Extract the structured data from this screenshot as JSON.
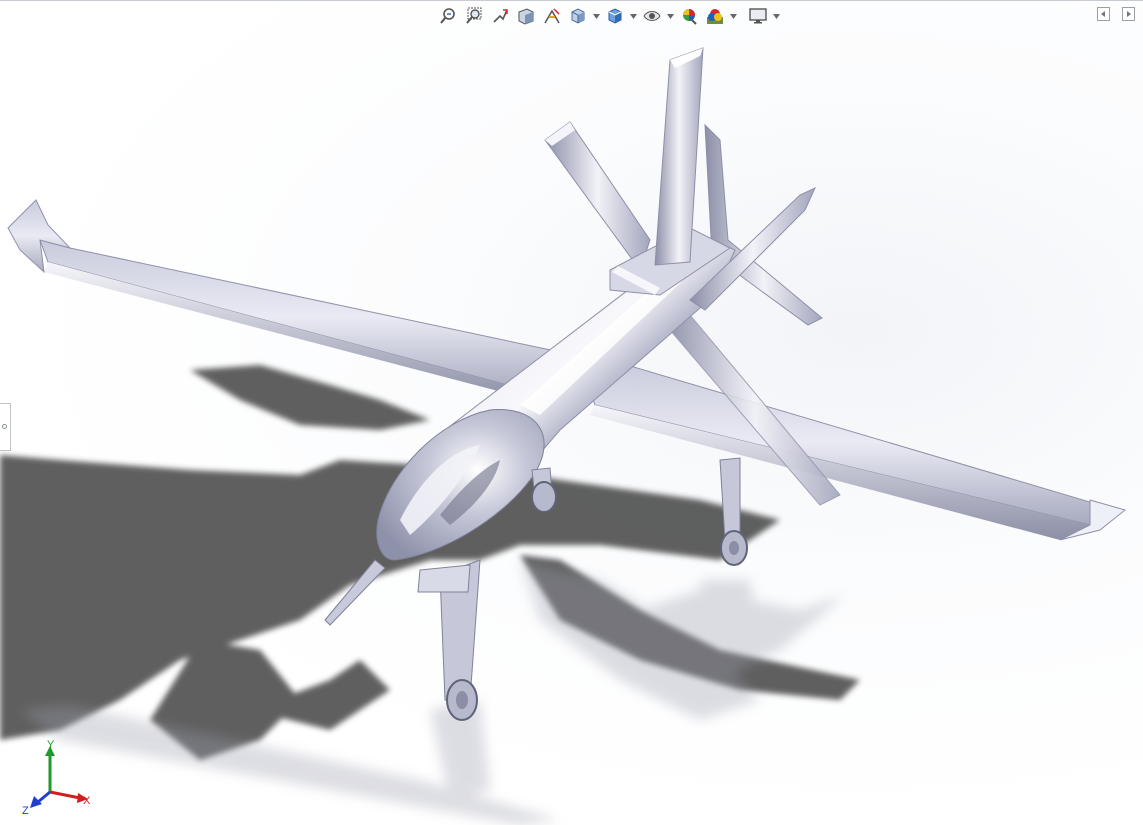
{
  "window": {
    "title": ""
  },
  "heads_up_toolbar": {
    "buttons": [
      {
        "name": "zoom-to-fit",
        "icon": "zoom-to-fit-icon"
      },
      {
        "name": "zoom-to-area",
        "icon": "zoom-to-area-icon"
      },
      {
        "name": "previous-view",
        "icon": "previous-view-icon"
      },
      {
        "name": "section-view",
        "icon": "section-view-icon"
      },
      {
        "name": "dynamic-annotation-views",
        "icon": "dynamic-annotation-icon"
      },
      {
        "name": "view-orientation",
        "icon": "view-orientation-icon",
        "dropdown": true
      },
      {
        "name": "display-style",
        "icon": "display-style-icon",
        "dropdown": true
      },
      {
        "name": "hide-show-items",
        "icon": "eye-icon",
        "dropdown": true
      },
      {
        "name": "edit-appearance",
        "icon": "appearance-icon"
      },
      {
        "name": "apply-scene",
        "icon": "scene-icon",
        "dropdown": true
      },
      {
        "name": "view-settings",
        "icon": "monitor-icon",
        "dropdown": true
      }
    ]
  },
  "triad": {
    "x_label": "X",
    "y_label": "Y",
    "z_label": "Z"
  },
  "colors": {
    "accent_red": "#d9262b",
    "accent_blue": "#1f5fbf",
    "axis_x": "#d01f1f",
    "axis_y": "#1f9a2a",
    "axis_z": "#1f3fd0",
    "model_metal": "#b6b9cc"
  },
  "model": {
    "name": "uav-model"
  }
}
